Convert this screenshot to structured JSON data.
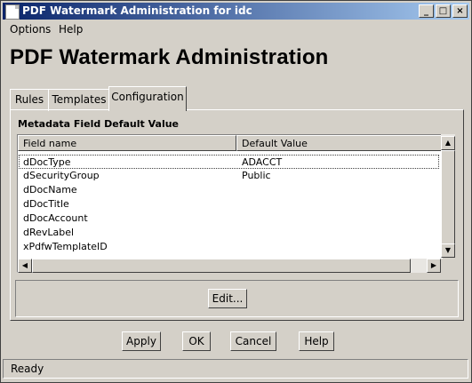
{
  "window": {
    "title": "PDF Watermark Administration for idc",
    "controls": {
      "minimize": "_",
      "maximize": "□",
      "close": "×"
    }
  },
  "menu": [
    "Options",
    "Help"
  ],
  "page_title": "PDF Watermark Administration",
  "tabs": [
    {
      "label": "Rules",
      "active": false
    },
    {
      "label": "Templates",
      "active": false
    },
    {
      "label": "Configuration",
      "active": true
    }
  ],
  "section_label": "Metadata Field Default Value",
  "table": {
    "columns": [
      "Field name",
      "Default Value"
    ],
    "rows": [
      {
        "field": "dDocType",
        "value": "ADACCT"
      },
      {
        "field": "dSecurityGroup",
        "value": "Public"
      },
      {
        "field": "dDocName",
        "value": ""
      },
      {
        "field": "dDocTitle",
        "value": ""
      },
      {
        "field": "dDocAccount",
        "value": ""
      },
      {
        "field": "dRevLabel",
        "value": ""
      },
      {
        "field": "xPdfwTemplateID",
        "value": ""
      }
    ]
  },
  "scroll_glyphs": {
    "up": "▲",
    "down": "▼",
    "left": "◀",
    "right": "▶"
  },
  "edit_button": "Edit...",
  "buttons": {
    "apply": "Apply",
    "ok": "OK",
    "cancel": "Cancel",
    "help": "Help"
  },
  "status": "Ready",
  "colors": {
    "titlebar_start": "#0a246a",
    "titlebar_end": "#a6caf0",
    "face": "#d4d0c8"
  }
}
